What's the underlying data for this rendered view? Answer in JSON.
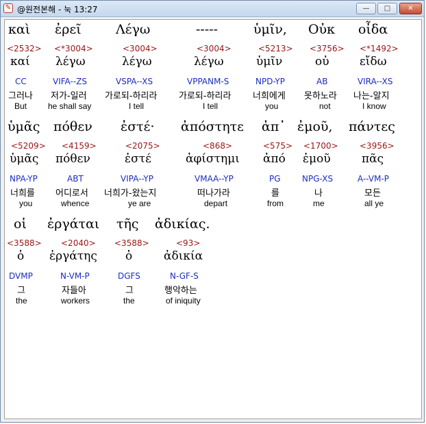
{
  "window": {
    "title": "@원전본해 - 눅 13:27",
    "minimize_glyph": "—",
    "maximize_glyph": "□",
    "close_glyph": "✕",
    "app_icon_glyph": "✎"
  },
  "colors": {
    "strong": "#9a1414",
    "morph": "#1a2cbf",
    "text": "#000000"
  },
  "rows": [
    [
      {
        "greek": "καὶ",
        "strong": "<2532>",
        "lemma": "καί",
        "morph": "CC",
        "korean": "그러나",
        "english": "But"
      },
      {
        "greek": "ἐρεῖ",
        "strong": "<*3004>",
        "lemma": "λέγω",
        "morph": "VIFA--ZS",
        "korean": "저가-일러",
        "english": "he shall say"
      },
      {
        "greek": "Λέγω",
        "strong": "<3004>",
        "lemma": "λέγω",
        "morph": "VSPA--XS",
        "korean": "가로되-하리라",
        "english": "I tell"
      },
      {
        "greek": "-----",
        "strong": "<3004>",
        "lemma": "λέγω",
        "morph": "VPPANM-S",
        "korean": "가로되-하리라",
        "english": "I tell"
      },
      {
        "greek": "ὑμῖν,",
        "strong": "<5213>",
        "lemma": "ὑμῖν",
        "morph": "NPD-YP",
        "korean": "너희에게",
        "english": "you"
      },
      {
        "greek": "Οὐκ",
        "strong": "<3756>",
        "lemma": "οὐ",
        "morph": "AB",
        "korean": "못하노라",
        "english": "not"
      },
      {
        "greek": "οἶδα",
        "strong": "<*1492>",
        "lemma": "εἴδω",
        "morph": "VIRA--XS",
        "korean": "나는-알지",
        "english": "I know"
      }
    ],
    [
      {
        "greek": "ὑμᾶς",
        "strong": "<5209>",
        "lemma": "ὑμᾶς",
        "morph": "NPA-YP",
        "korean": "너희를",
        "english": "you"
      },
      {
        "greek": "πόθεν",
        "strong": "<4159>",
        "lemma": "πόθεν",
        "morph": "ABT",
        "korean": "어디로서",
        "english": "whence"
      },
      {
        "greek": "ἐστέ·",
        "strong": "<2075>",
        "lemma": "ἐστέ",
        "morph": "VIPA--YP",
        "korean": "너희가-왔는지",
        "english": "ye are"
      },
      {
        "greek": "ἀπόστητε",
        "strong": "<868>",
        "lemma": "ἀφίστημι",
        "morph": "VMAA--YP",
        "korean": "떠나가라",
        "english": "depart"
      },
      {
        "greek": "ἀπ᾽",
        "strong": "<575>",
        "lemma": "ἀπό",
        "morph": "PG",
        "korean": "를",
        "english": "from"
      },
      {
        "greek": "ἐμοῦ,",
        "strong": "<1700>",
        "lemma": "ἐμοῦ",
        "morph": "NPG-XS",
        "korean": "나",
        "english": "me"
      },
      {
        "greek": "πάντες",
        "strong": "<3956>",
        "lemma": "πᾶς",
        "morph": "A--VM-P",
        "korean": "모든",
        "english": "all ye"
      }
    ],
    [
      {
        "greek": "οἱ",
        "strong": "<3588>",
        "lemma": "ὁ",
        "morph": "DVMP",
        "korean": "그",
        "english": "the"
      },
      {
        "greek": "ἐργάται",
        "strong": "<2040>",
        "lemma": "ἐργάτης",
        "morph": "N-VM-P",
        "korean": "자들아",
        "english": "workers"
      },
      {
        "greek": "τῆς",
        "strong": "<3588>",
        "lemma": "ὁ",
        "morph": "DGFS",
        "korean": "그",
        "english": "the"
      },
      {
        "greek": "ἀδικίας.",
        "strong": "<93>",
        "lemma": "ἀδικία",
        "morph": "N-GF-S",
        "korean": "행악하는",
        "english": "of iniquity"
      }
    ]
  ]
}
